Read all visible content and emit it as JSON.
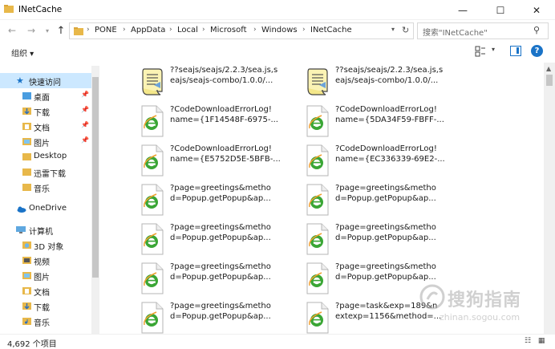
{
  "window": {
    "title": "INetCache"
  },
  "address": {
    "crumbs": [
      "PONE",
      "AppData",
      "Local",
      "Microsoft",
      "Windows",
      "INetCache"
    ],
    "search_placeholder": "搜索\"INetCache\""
  },
  "toolbar": {
    "organize_label": "组织 ▾"
  },
  "sidebar": {
    "quick_access": "快速访问",
    "quick_items": [
      "桌面",
      "下载",
      "文档",
      "图片",
      "Desktop",
      "迅雷下载",
      "音乐"
    ],
    "onedrive": "OneDrive",
    "this_pc": "计算机",
    "pc_items": [
      "3D 对象",
      "视频",
      "图片",
      "文档",
      "下载",
      "音乐"
    ]
  },
  "files": [
    {
      "name": "??seajs/seajs/2.2.3/sea.js,s\neajs/seajs-combo/1.0.0/...",
      "icon": "script-icon"
    },
    {
      "name": "??seajs/seajs/2.2.3/sea.js,s\neajs/seajs-combo/1.0.0/...",
      "icon": "script-icon"
    },
    {
      "name": "?CodeDownloadErrorLog!\nname={1F14548F-6975-...",
      "icon": "ie-icon"
    },
    {
      "name": "?CodeDownloadErrorLog!\nname={5DA34F59-FBFF-...",
      "icon": "ie-icon"
    },
    {
      "name": "?CodeDownloadErrorLog!\nname={E5752D5E-5BFB-...",
      "icon": "ie-icon"
    },
    {
      "name": "?CodeDownloadErrorLog!\nname={EC336339-69E2-...",
      "icon": "ie-icon"
    },
    {
      "name": "?page=greetings&metho\nd=Popup.getPopup&ap...",
      "icon": "ie-icon"
    },
    {
      "name": "?page=greetings&metho\nd=Popup.getPopup&ap...",
      "icon": "ie-icon"
    },
    {
      "name": "?page=greetings&metho\nd=Popup.getPopup&ap...",
      "icon": "ie-icon"
    },
    {
      "name": "?page=greetings&metho\nd=Popup.getPopup&ap...",
      "icon": "ie-icon"
    },
    {
      "name": "?page=greetings&metho\nd=Popup.getPopup&ap...",
      "icon": "ie-icon"
    },
    {
      "name": "?page=greetings&metho\nd=Popup.getPopup&ap...",
      "icon": "ie-icon"
    },
    {
      "name": "?page=greetings&metho\nd=Popup.getPopup&ap...",
      "icon": "ie-icon"
    },
    {
      "name": "?page=task&exp=189&n\nextexp=1156&method=...",
      "icon": "ie-icon"
    }
  ],
  "status": {
    "count": "4,692 个项目"
  },
  "watermark": {
    "text": "搜狗指南",
    "url": "zhinan.sogou.com"
  },
  "colors": {
    "accent": "#1a73c7",
    "selected": "#cce8ff",
    "folder": "#e8b84a",
    "ie_green": "#3aa635"
  }
}
